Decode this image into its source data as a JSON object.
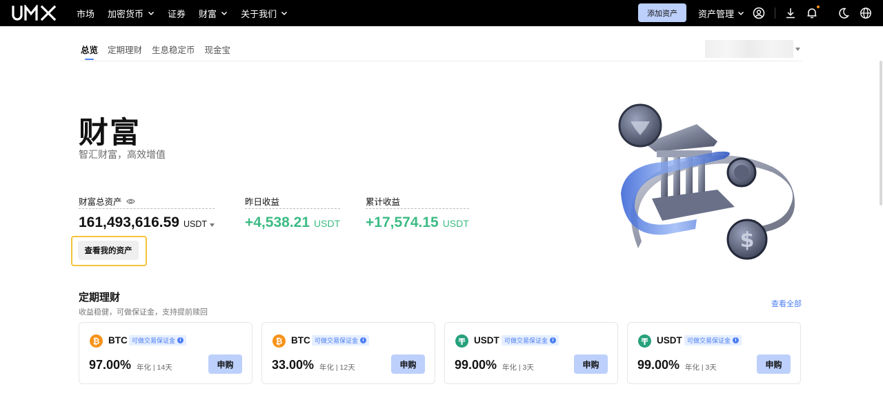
{
  "header": {
    "logo_text": "UMX",
    "nav": [
      {
        "label": "市场",
        "has_dropdown": false
      },
      {
        "label": "加密货币",
        "has_dropdown": true
      },
      {
        "label": "证券",
        "has_dropdown": false
      },
      {
        "label": "财富",
        "has_dropdown": true
      },
      {
        "label": "关于我们",
        "has_dropdown": true
      }
    ],
    "add_asset_label": "添加资产",
    "asset_mgmt_label": "资产管理",
    "icons": [
      "user-icon",
      "download-icon",
      "bell-icon",
      "moon-icon",
      "globe-icon"
    ]
  },
  "subnav": {
    "tabs": [
      "总览",
      "定期理财",
      "生息稳定币",
      "现金宝"
    ],
    "active": "总览"
  },
  "hero": {
    "title": "财富",
    "subtitle": "智汇财富，高效增值"
  },
  "stats": {
    "total_label": "财富总资产",
    "total_value": "161,493,616.59",
    "total_unit": "USDT",
    "yesterday_label": "昨日收益",
    "yesterday_value": "+4,538.21",
    "yesterday_unit": "USDT",
    "cumulative_label": "累计收益",
    "cumulative_value": "+17,574.15",
    "cumulative_unit": "USDT"
  },
  "view_assets_label": "查看我的资产",
  "fixed_section": {
    "title": "定期理财",
    "subtitle": "收益稳健，可做保证金，支持提前赎回",
    "view_all": "查看全部",
    "cards": [
      {
        "coin": "BTC",
        "badge": "可做交易保证金",
        "rate": "97.00%",
        "meta": "年化 | 14天",
        "buy": "申购",
        "coin_color": "#f7931a"
      },
      {
        "coin": "BTC",
        "badge": "可做交易保证金",
        "rate": "33.00%",
        "meta": "年化 | 12天",
        "buy": "申购",
        "coin_color": "#f7931a"
      },
      {
        "coin": "USDT",
        "badge": "可做交易保证金",
        "rate": "99.00%",
        "meta": "年化 | 3天",
        "buy": "申购",
        "coin_color": "#26a17b"
      },
      {
        "coin": "USDT",
        "badge": "可做交易保证金",
        "rate": "99.00%",
        "meta": "年化 | 3天",
        "buy": "申购",
        "coin_color": "#26a17b"
      }
    ]
  },
  "colors": {
    "accent": "#4c7ef3",
    "positive": "#3dbb84",
    "button_bg": "#bcd0fb",
    "highlight_border": "#f5c33b"
  }
}
